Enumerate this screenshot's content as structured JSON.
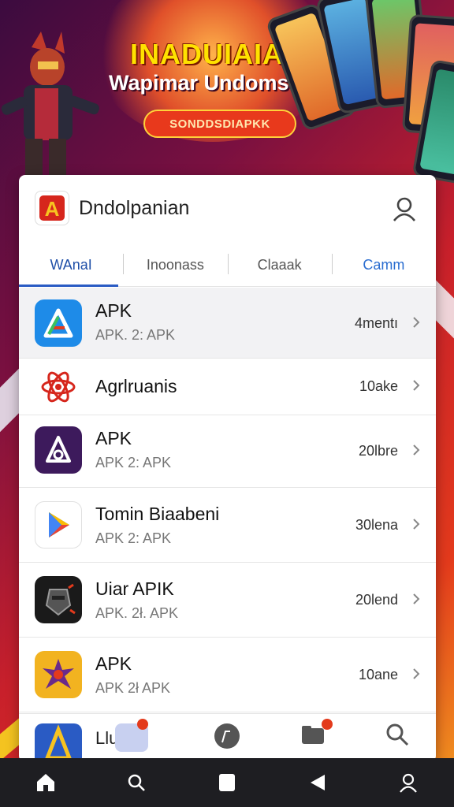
{
  "hero": {
    "title": "INADUIAIA",
    "subtitle": "Wapimar Undomsiai",
    "button": "SONDDSDIAPKK"
  },
  "header": {
    "title": "Dndolpanian",
    "profile_icon": "person-icon"
  },
  "tabs": [
    {
      "label": "WAnaI"
    },
    {
      "label": "Inoonass"
    },
    {
      "label": "Claaak"
    },
    {
      "label": "Camm"
    }
  ],
  "apps": [
    {
      "name": "APK",
      "sub": "APK. 2: APK",
      "size": "4mentı",
      "icon": "app-store-icon"
    },
    {
      "name": "Agrlruanis",
      "sub": "",
      "size": "10ake",
      "icon": "atom-icon"
    },
    {
      "name": "APK",
      "sub": "APK 2: APK",
      "size": "20lbre",
      "icon": "a-logo-icon"
    },
    {
      "name": "Tomin Biaabeni",
      "sub": "APK 2: APK",
      "size": "30lena",
      "icon": "play-triangle-icon"
    },
    {
      "name": "Uiar APIK",
      "sub": "APK. 2ł. APK",
      "size": "20lend",
      "icon": "warrior-icon"
    },
    {
      "name": "APK",
      "sub": "APK 2ł APK",
      "size": "10ane",
      "icon": "star-burst-icon"
    }
  ],
  "bottom_strip": [
    {
      "label": "Llu",
      "icon": "a-app-icon"
    },
    {
      "label": "",
      "icon": "chat-icon"
    },
    {
      "label": "",
      "icon": "folder-icon"
    },
    {
      "label": "",
      "icon": "search-icon"
    }
  ],
  "nav": [
    {
      "icon": "home-icon"
    },
    {
      "icon": "search-icon"
    },
    {
      "icon": "square-icon"
    },
    {
      "icon": "back-icon"
    },
    {
      "icon": "person-icon"
    }
  ],
  "colors": {
    "accent": "#2a5bc4",
    "hero_button": "#e8391c",
    "hero_title": "#ffe200"
  }
}
